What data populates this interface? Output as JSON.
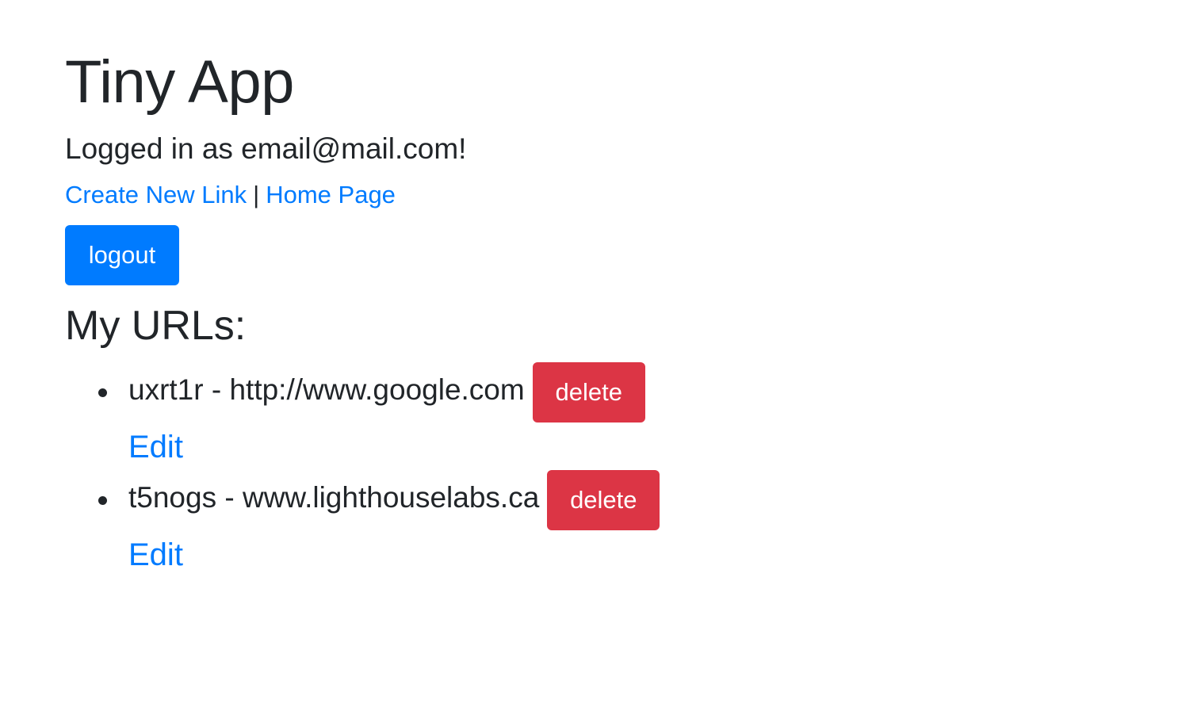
{
  "header": {
    "title": "Tiny App",
    "logged_in_text": "Logged in as email@mail.com!"
  },
  "nav": {
    "create_link_label": "Create New Link",
    "separator": "|",
    "home_link_label": "Home Page"
  },
  "logout_label": "logout",
  "urls_heading": "My URLs:",
  "urls": [
    {
      "text": "uxrt1r - http://www.google.com",
      "delete_label": "delete",
      "edit_label": "Edit"
    },
    {
      "text": "t5nogs - www.lighthouselabs.ca",
      "delete_label": "delete",
      "edit_label": "Edit"
    }
  ],
  "colors": {
    "link": "#007bff",
    "primary_button": "#007bff",
    "danger_button": "#dc3545",
    "text": "#212529",
    "background": "#ffffff"
  }
}
